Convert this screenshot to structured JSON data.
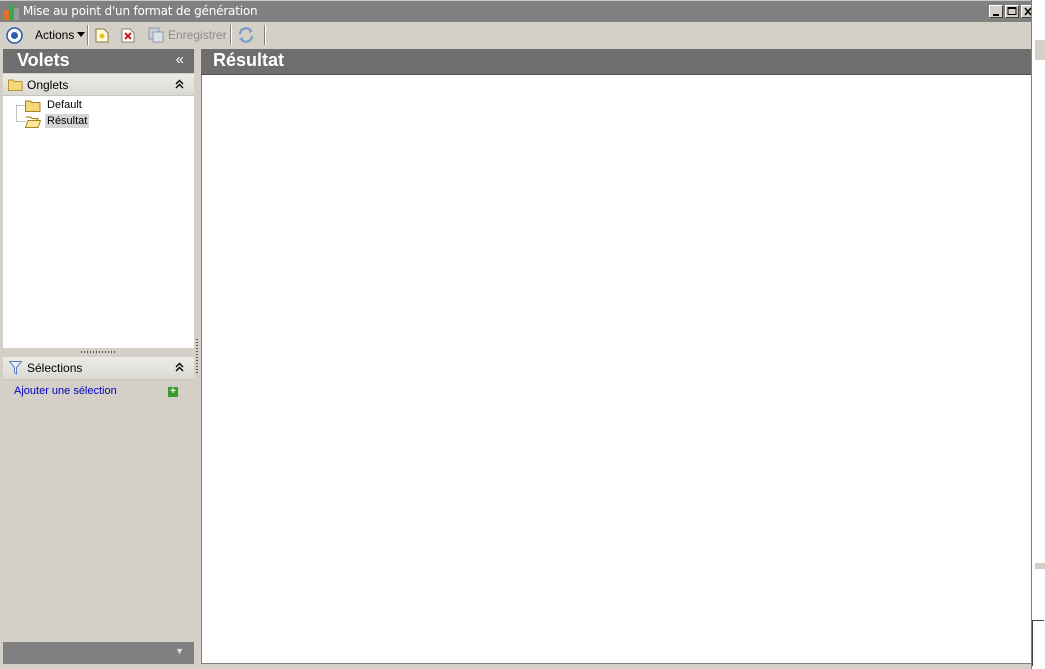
{
  "window": {
    "title": "Mise au point d'un format de génération"
  },
  "toolbar": {
    "actions_label": "Actions",
    "save_label": "Enregistrer"
  },
  "left_pane": {
    "title": "Volets",
    "collapse_glyph": "«",
    "tabs_section": {
      "title": "Onglets",
      "items": [
        {
          "label": "Default",
          "selected": false
        },
        {
          "label": "Résultat",
          "selected": true
        }
      ]
    },
    "selections_section": {
      "title": "Sélections",
      "add_link": "Ajouter une sélection"
    }
  },
  "content": {
    "title": "Résultat"
  },
  "colors": {
    "header_gray": "#6e6e6e",
    "link_blue": "#0000c0",
    "add_green": "#3c9a2c"
  }
}
